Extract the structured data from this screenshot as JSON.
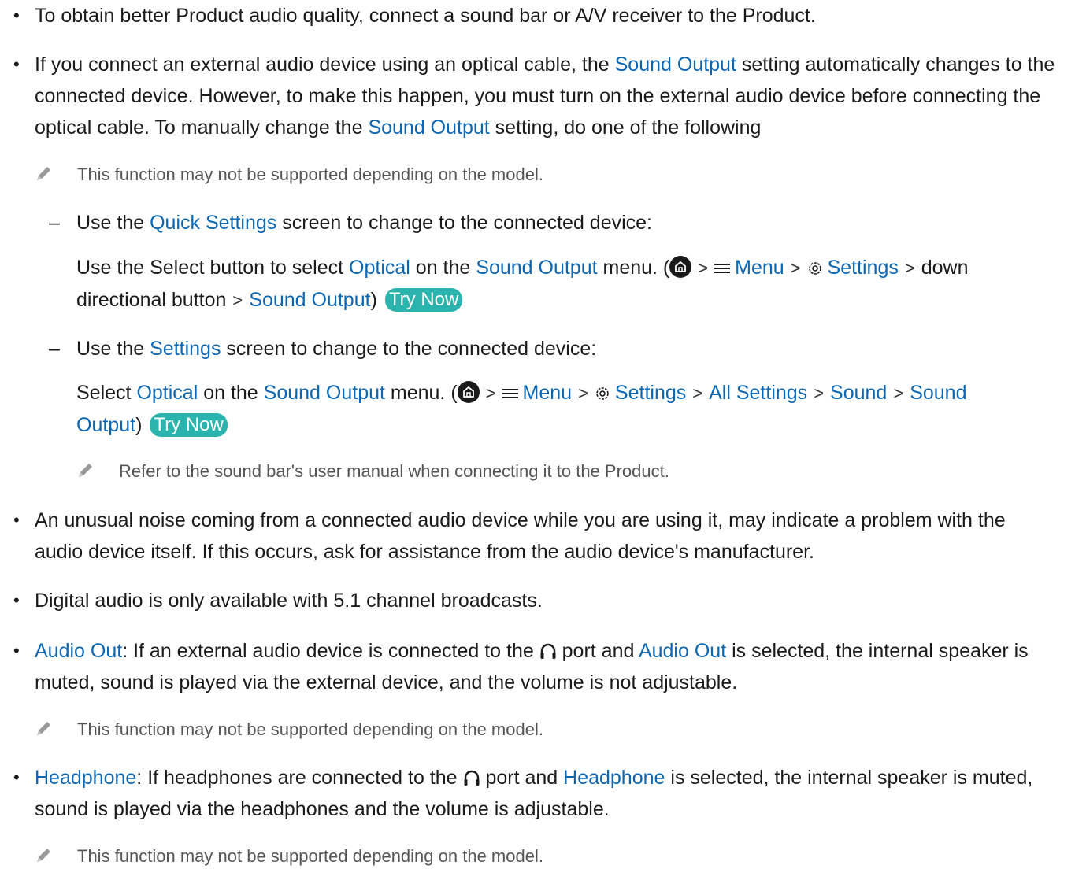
{
  "items": [
    {
      "text": "To obtain better Product audio quality, connect a sound bar or A/V receiver to the Product."
    },
    {
      "p1": "If you connect an external audio device using an optical cable, the ",
      "l1": "Sound Output",
      "p2": " setting automatically changes to the connected device. However, to make this happen, you must turn on the external audio device before connecting the optical cable. To manually change the ",
      "l2": "Sound Output",
      "p3": " setting, do one of the following",
      "note": "This function may not be supported depending on the model.",
      "opt1": {
        "intro_a": "Use the ",
        "intro_link": "Quick Settings",
        "intro_b": " screen to change to the connected device:",
        "d1": "Use the Select button to select ",
        "optical": "Optical",
        "d2": " on the ",
        "sound_output": "Sound Output",
        "d3": " menu. (",
        "menu": "Menu",
        "settings": "Settings",
        "down": "down directional button",
        "path_end": "Sound Output",
        "close": ")",
        "try_now": "Try Now"
      },
      "opt2": {
        "intro_a": "Use the ",
        "intro_link": "Settings",
        "intro_b": " screen to change to the connected device:",
        "d1": "Select ",
        "optical": "Optical",
        "d2": " on the ",
        "sound_output": "Sound Output",
        "d3": " menu. (",
        "menu": "Menu",
        "settings": "Settings",
        "all_settings": "All Settings",
        "sound": "Sound",
        "sound_output_end_a": "Sound",
        "sound_output_end_b": "Output",
        "close": ")",
        "try_now": "Try Now",
        "note": "Refer to the sound bar's user manual when connecting it to the Product."
      }
    },
    {
      "text": "An unusual noise coming from a connected audio device while you are using it, may indicate a problem with the audio device itself. If this occurs, ask for assistance from the audio device's manufacturer."
    },
    {
      "text": "Digital audio is only available with 5.1 channel broadcasts."
    },
    {
      "l1": "Audio Out",
      "p1": ": If an external audio device is connected to the ",
      "p2": " port and ",
      "l2": "Audio Out",
      "p3": " is selected, the internal speaker is muted, sound is played via the external device, and the volume is not adjustable.",
      "note": "This function may not be supported depending on the model."
    },
    {
      "l1": "Headphone",
      "p1": ": If headphones are connected to the ",
      "p2": " port and ",
      "l2": "Headphone",
      "p3": " is selected, the internal speaker is muted, sound is played via the headphones and the volume is adjustable.",
      "note": "This function may not be supported depending on the model."
    }
  ],
  "bullet_char": "•",
  "dash_char": "–",
  "sep_char": ">",
  "link_color": "#0b66b3",
  "try_now_color": "#2bb3ad",
  "icons": [
    "pencil-icon",
    "home-icon",
    "menu-icon",
    "gear-icon",
    "headphone-icon"
  ]
}
